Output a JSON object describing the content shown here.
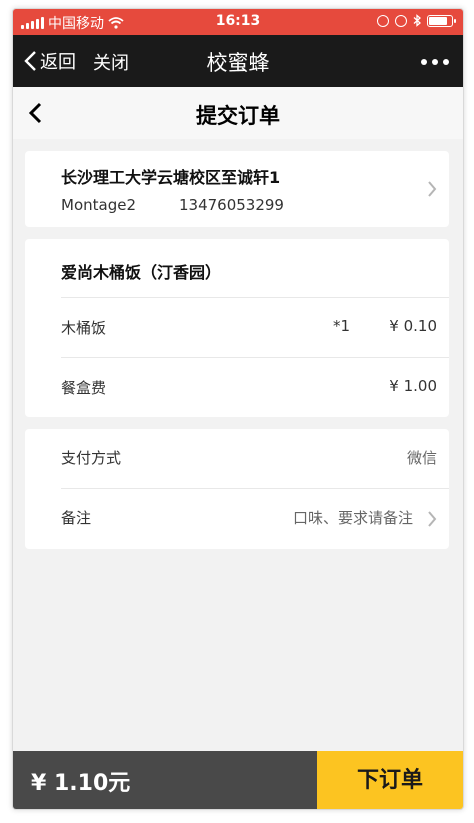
{
  "status_bar": {
    "carrier": "中国移动",
    "time": "16:13",
    "battery_level": 0.85
  },
  "wechat_nav": {
    "back_label": "返回",
    "close_label": "关闭",
    "title": "校蜜蜂"
  },
  "page": {
    "title": "提交订单"
  },
  "address": {
    "line": "长沙理工大学云塘校区至诚轩1",
    "name": "Montage2",
    "phone": "13476053299"
  },
  "order": {
    "shop_name": "爱尚木桶饭（汀香园）",
    "items": [
      {
        "name": "木桶饭",
        "qty": "*1",
        "price": "¥ 0.10"
      }
    ],
    "box_fee_label": "餐盒费",
    "box_fee": "¥ 1.00"
  },
  "payment": {
    "method_label": "支付方式",
    "method_value": "微信",
    "remark_label": "备注",
    "remark_placeholder": "口味、要求请备注"
  },
  "footer": {
    "total": "¥ 1.10元",
    "submit_label": "下订单"
  },
  "colors": {
    "status_bar": "#e64a3d",
    "nav_bar": "#1a1a1a",
    "submit_button": "#fcc421",
    "total_bar": "#494949"
  }
}
